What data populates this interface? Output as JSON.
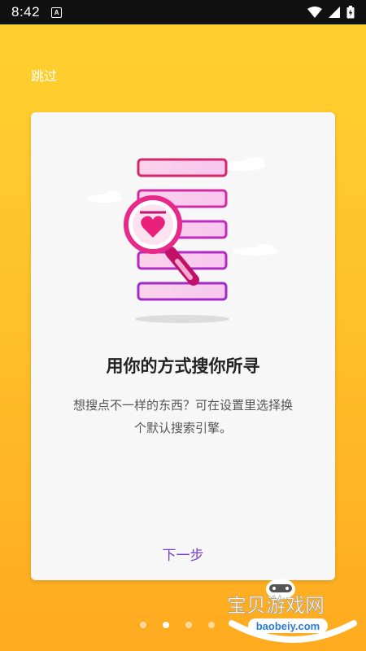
{
  "status_bar": {
    "time": "8:42",
    "notification_icon": "A",
    "icons": [
      "wifi-icon",
      "signal-icon",
      "battery-icon"
    ]
  },
  "skip_label": "跳过",
  "card": {
    "title": "用你的方式搜你所寻",
    "description_line1": "想搜点不一样的东西？可在设置里选择换",
    "description_line2": "个默认搜索引擎。",
    "next_label": "下一步"
  },
  "pager": {
    "count": 4,
    "active_index": 1
  },
  "watermark": {
    "brand": "宝贝游戏网",
    "domain": "baobeiy.com"
  },
  "colors": {
    "background_top": "#ffd230",
    "background_bottom": "#ffab1f",
    "accent": "#7a3fd0",
    "heart": "#e8207a"
  }
}
